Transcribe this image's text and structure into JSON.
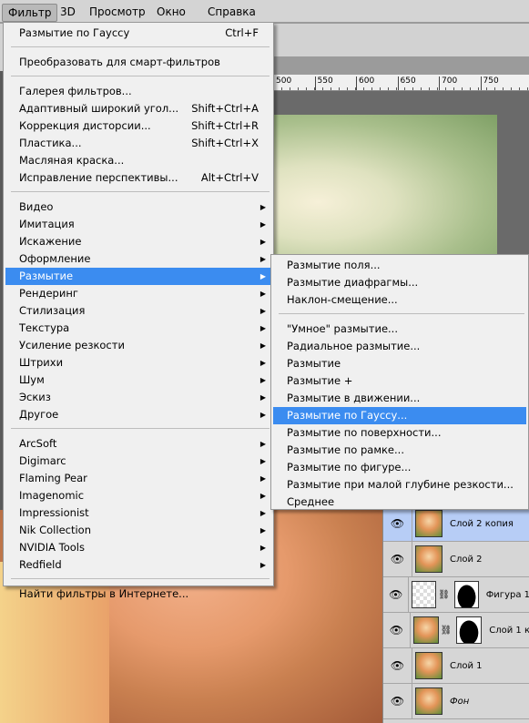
{
  "menubar": {
    "items": [
      "Фильтр",
      "3D",
      "Просмотр",
      "Окно",
      "Справка"
    ]
  },
  "ruler": {
    "labels": [
      "500",
      "550",
      "600",
      "650",
      "700",
      "750"
    ]
  },
  "filter_menu": {
    "groups": [
      [
        {
          "label": "Размытие по Гауссу",
          "shortcut": "Ctrl+F"
        }
      ],
      [
        {
          "label": "Преобразовать для смарт-фильтров"
        }
      ],
      [
        {
          "label": "Галерея фильтров..."
        },
        {
          "label": "Адаптивный широкий угол...",
          "shortcut": "Shift+Ctrl+A"
        },
        {
          "label": "Коррекция дисторсии...",
          "shortcut": "Shift+Ctrl+R"
        },
        {
          "label": "Пластика...",
          "shortcut": "Shift+Ctrl+X"
        },
        {
          "label": "Масляная краска..."
        },
        {
          "label": "Исправление перспективы...",
          "shortcut": "Alt+Ctrl+V"
        }
      ],
      [
        {
          "label": "Видео",
          "submenu": true
        },
        {
          "label": "Имитация",
          "submenu": true
        },
        {
          "label": "Искажение",
          "submenu": true
        },
        {
          "label": "Оформление",
          "submenu": true
        },
        {
          "label": "Размытие",
          "submenu": true,
          "highlighted": true
        },
        {
          "label": "Рендеринг",
          "submenu": true
        },
        {
          "label": "Стилизация",
          "submenu": true
        },
        {
          "label": "Текстура",
          "submenu": true
        },
        {
          "label": "Усиление резкости",
          "submenu": true
        },
        {
          "label": "Штрихи",
          "submenu": true
        },
        {
          "label": "Шум",
          "submenu": true
        },
        {
          "label": "Эскиз",
          "submenu": true
        },
        {
          "label": "Другое",
          "submenu": true
        }
      ],
      [
        {
          "label": "ArcSoft",
          "submenu": true
        },
        {
          "label": "Digimarc",
          "submenu": true
        },
        {
          "label": "Flaming Pear",
          "submenu": true
        },
        {
          "label": "Imagenomic",
          "submenu": true
        },
        {
          "label": "Impressionist",
          "submenu": true
        },
        {
          "label": "Nik Collection",
          "submenu": true
        },
        {
          "label": "NVIDIA Tools",
          "submenu": true
        },
        {
          "label": "Redfield",
          "submenu": true
        }
      ],
      [
        {
          "label": "Найти фильтры в Интернете..."
        }
      ]
    ]
  },
  "blur_submenu": {
    "groups": [
      [
        {
          "label": "Размытие поля..."
        },
        {
          "label": "Размытие диафрагмы..."
        },
        {
          "label": "Наклон-смещение..."
        }
      ],
      [
        {
          "label": "\"Умное\" размытие..."
        },
        {
          "label": "Радиальное размытие..."
        },
        {
          "label": "Размытие"
        },
        {
          "label": "Размытие +"
        },
        {
          "label": "Размытие в движении..."
        },
        {
          "label": "Размытие по Гауссу...",
          "highlighted": true
        },
        {
          "label": "Размытие по поверхности..."
        },
        {
          "label": "Размытие по рамке..."
        },
        {
          "label": "Размытие по фигуре..."
        },
        {
          "label": "Размытие при малой глубине резкости..."
        },
        {
          "label": "Среднее"
        }
      ]
    ]
  },
  "layers": [
    {
      "name": "Слой 2 копия",
      "selected": true,
      "type": "photo"
    },
    {
      "name": "Слой 2",
      "type": "photo"
    },
    {
      "name": "Фигура 1",
      "type": "shape-mask"
    },
    {
      "name": "Слой 1 к",
      "type": "photo-mask"
    },
    {
      "name": "Слой 1",
      "type": "photo"
    },
    {
      "name": "Фон",
      "type": "photo",
      "italic": true
    }
  ],
  "colors": {
    "highlight": "#3b8cf0",
    "layer_selected": "#b7cdf6"
  }
}
